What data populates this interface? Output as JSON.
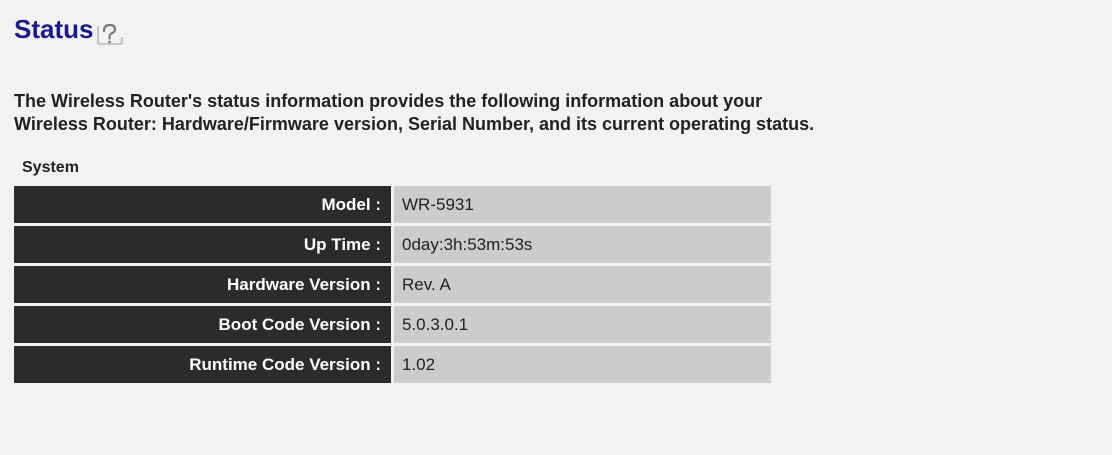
{
  "page": {
    "title": "Status",
    "help_icon": "help-question-icon",
    "description": [
      "The Wireless Router's status information provides the following information about your",
      "Wireless Router: Hardware/Firmware version, Serial Number, and its current operating status."
    ]
  },
  "system": {
    "section_label": "System",
    "rows": [
      {
        "label": "Model :",
        "value": "WR-5931"
      },
      {
        "label": "Up Time :",
        "value": "0day:3h:53m:53s"
      },
      {
        "label": "Hardware Version :",
        "value": "Rev. A"
      },
      {
        "label": "Boot Code Version :",
        "value": "5.0.3.0.1"
      },
      {
        "label": "Runtime Code Version :",
        "value": "1.02"
      }
    ]
  },
  "colors": {
    "title": "#1a1a8c",
    "label_bg": "#2b2b2b",
    "value_bg": "#cccccc",
    "page_bg": "#f2f2f2"
  }
}
